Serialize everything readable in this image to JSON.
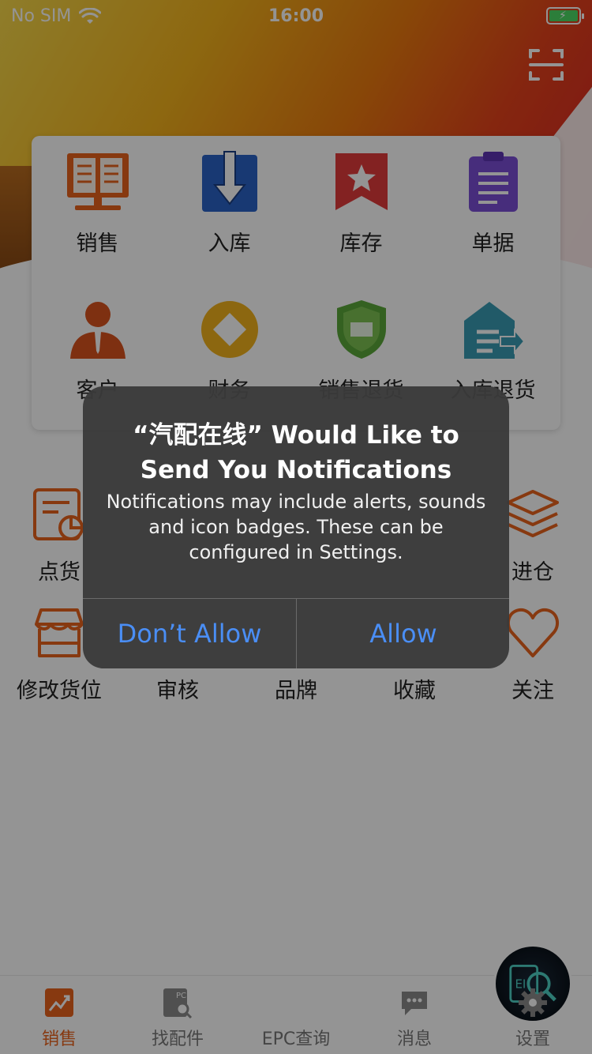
{
  "status_bar": {
    "carrier": "No SIM",
    "time": "16:00"
  },
  "main_grid": [
    {
      "label": "销售",
      "icon": "sales-book-icon"
    },
    {
      "label": "入库",
      "icon": "stock-in-icon"
    },
    {
      "label": "库存",
      "icon": "inventory-bookmark-icon"
    },
    {
      "label": "单据",
      "icon": "documents-clipboard-icon"
    },
    {
      "label": "客户",
      "icon": "customer-icon"
    },
    {
      "label": "财务",
      "icon": "finance-icon"
    },
    {
      "label": "销售退货",
      "icon": "sales-return-icon"
    },
    {
      "label": "入库退货",
      "icon": "stock-return-icon"
    }
  ],
  "secondary_grid": [
    {
      "label": "点货",
      "icon": "check-goods-icon"
    },
    {
      "label": "进仓",
      "icon": "warehouse-in-icon"
    },
    {
      "label": "修改货位",
      "icon": "edit-location-icon"
    },
    {
      "label": "审核",
      "icon": "audit-icon"
    },
    {
      "label": "品牌",
      "icon": "brand-icon"
    },
    {
      "label": "收藏",
      "icon": "favorite-icon"
    },
    {
      "label": "关注",
      "icon": "heart-icon"
    }
  ],
  "tab_bar": [
    {
      "label": "销售",
      "icon": "sales-chart-icon",
      "active": true
    },
    {
      "label": "找配件",
      "icon": "find-parts-icon",
      "active": false
    },
    {
      "label": "EPC查询",
      "icon": "epc-query-icon",
      "active": false
    },
    {
      "label": "消息",
      "icon": "message-icon",
      "active": false
    },
    {
      "label": "设置",
      "icon": "settings-gear-icon",
      "active": false
    }
  ],
  "alert": {
    "title_line1": "“汽配在线” Would Like to",
    "title_line2": "Send You Notifications",
    "message": "Notifications may include alerts, sounds and icon badges. These can be configured in Settings.",
    "deny_label": "Don’t Allow",
    "allow_label": "Allow"
  },
  "colors": {
    "accent": "#e8621c",
    "alert_button": "#4a8ef5"
  }
}
